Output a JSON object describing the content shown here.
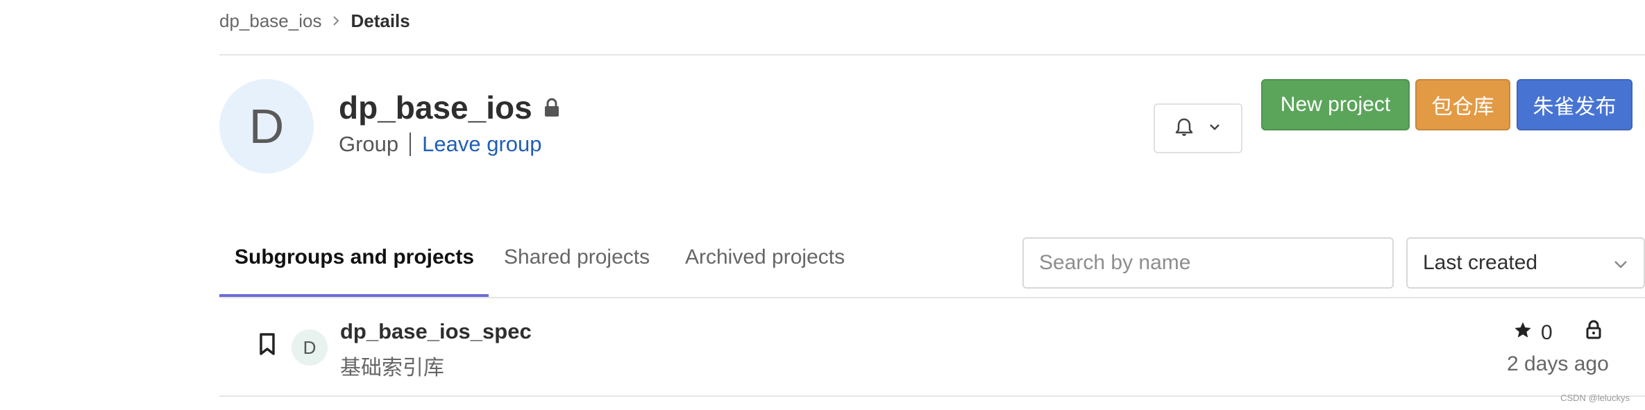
{
  "breadcrumb": {
    "group": "dp_base_ios",
    "current": "Details"
  },
  "group": {
    "avatar_letter": "D",
    "name": "dp_base_ios",
    "type_label": "Group",
    "leave_link": "Leave group"
  },
  "actions": {
    "new_project": "New project",
    "package_repo": "包仓库",
    "publish": "朱雀发布"
  },
  "tabs": [
    {
      "label": "Subgroups and projects",
      "active": true
    },
    {
      "label": "Shared projects",
      "active": false
    },
    {
      "label": "Archived projects",
      "active": false
    }
  ],
  "search": {
    "placeholder": "Search by name",
    "value": ""
  },
  "sort": {
    "selected": "Last created"
  },
  "projects": [
    {
      "avatar_letter": "D",
      "name": "dp_base_ios_spec",
      "description": "基础索引库",
      "stars": "0",
      "updated": "2 days ago"
    }
  ],
  "watermark": "CSDN @leluckys",
  "colors": {
    "new_project": "#5ba55b",
    "package_repo": "#e39a45",
    "publish": "#4774d3",
    "link": "#1f5fb4",
    "tab_indicator": "#6b6bd6"
  },
  "icons": [
    "chevron-right-icon",
    "lock-icon",
    "bell-icon",
    "chevron-down-icon",
    "bookmark-icon",
    "star-icon"
  ]
}
